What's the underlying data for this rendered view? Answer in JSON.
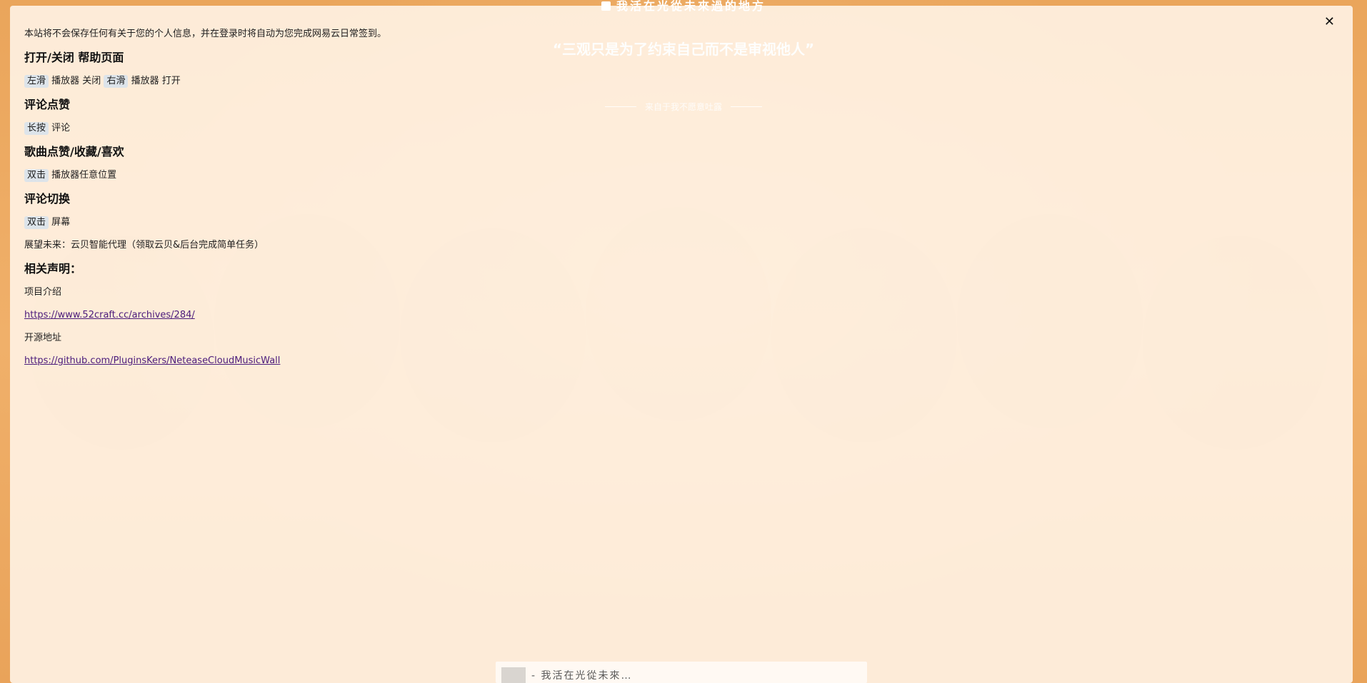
{
  "background": {
    "song_title": "我活在光從未來過的地方",
    "quote": "“三观只是为了约束自己而不是审视他人”",
    "sub": "来自于我不愿意吐露"
  },
  "modal": {
    "close_label": "✕",
    "intro": "本站将不会保存任何有关于您的个人信息，并在登录时将自动为您完成网易云日常签到。",
    "sections": [
      {
        "heading": "打开/关闭 帮助页面",
        "k1": "左滑",
        "t1": "播放器 关闭",
        "k2": "右滑",
        "t2": "播放器 打开"
      },
      {
        "heading": "评论点赞",
        "k1": "长按",
        "t1": "评论"
      },
      {
        "heading": "歌曲点赞/收藏/喜欢",
        "k1": "双击",
        "t1": "播放器任意位置"
      },
      {
        "heading": "评论切换",
        "k1": "双击",
        "t1": "屏幕"
      }
    ],
    "future": "展望未来：云贝智能代理（领取云贝&后台完成简单任务）",
    "statement_heading": "相关声明：",
    "project_label": "项目介绍",
    "project_link": "https://www.52craft.cc/archives/284/",
    "source_label": "开源地址",
    "source_link": "https://github.com/PluginsKers/NeteaseCloudMusicWall"
  },
  "player": {
    "now_playing": "- 我活在光從未來…"
  }
}
